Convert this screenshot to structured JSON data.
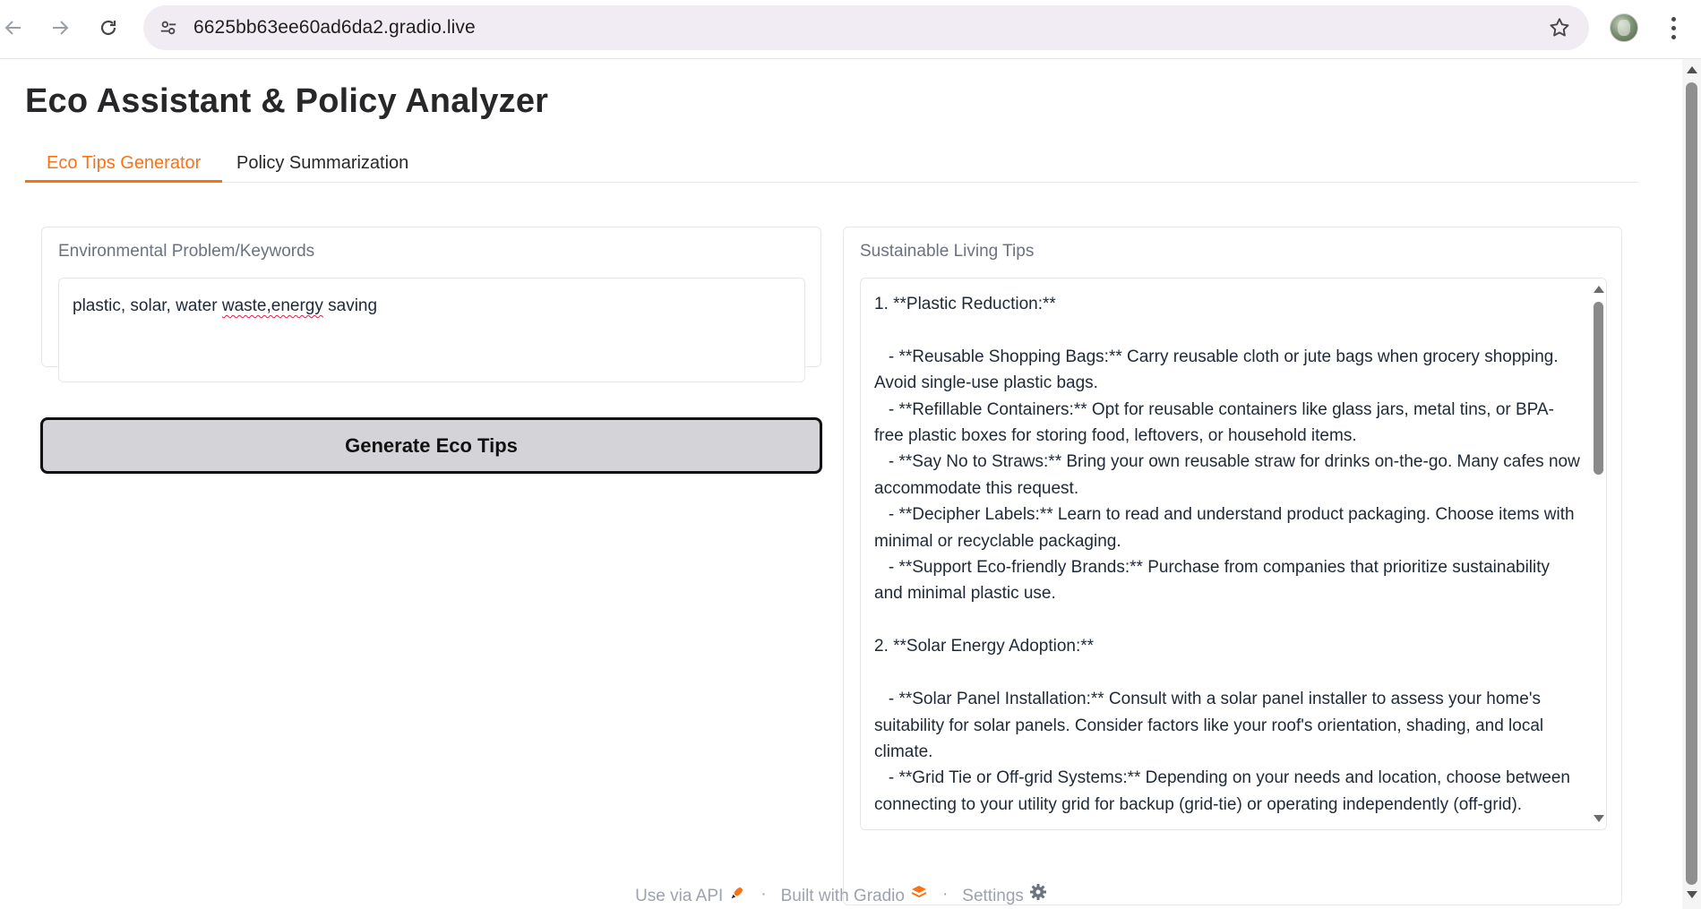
{
  "browser": {
    "url": "6625bb63ee60ad6da2.gradio.live",
    "icons": {
      "back": "arrow-left-icon",
      "forward": "arrow-right-icon",
      "reload": "reload-icon",
      "site_info": "tune-icon",
      "bookmark": "star-icon",
      "menu": "kebab-icon"
    }
  },
  "app": {
    "title": "Eco Assistant & Policy Analyzer",
    "accent_color": "#f97316",
    "tabs": [
      {
        "label": "Eco Tips Generator",
        "active": true
      },
      {
        "label": "Policy Summarization",
        "active": false
      }
    ],
    "input": {
      "label": "Environmental Problem/Keywords",
      "value_prefix": "plastic, solar, water ",
      "value_misspelled": "waste,energy",
      "value_suffix": " saving"
    },
    "generate_button": "Generate Eco Tips",
    "output": {
      "label": "Sustainable Living Tips",
      "text": "1. **Plastic Reduction:**\n\n   - **Reusable Shopping Bags:** Carry reusable cloth or jute bags when grocery shopping. Avoid single-use plastic bags.\n   - **Refillable Containers:** Opt for reusable containers like glass jars, metal tins, or BPA-free plastic boxes for storing food, leftovers, or household items.\n   - **Say No to Straws:** Bring your own reusable straw for drinks on-the-go. Many cafes now accommodate this request.\n   - **Decipher Labels:** Learn to read and understand product packaging. Choose items with minimal or recyclable packaging.\n   - **Support Eco-friendly Brands:** Purchase from companies that prioritize sustainability and minimal plastic use.\n\n2. **Solar Energy Adoption:**\n\n   - **Solar Panel Installation:** Consult with a solar panel installer to assess your home's suitability for solar panels. Consider factors like your roof's orientation, shading, and local climate.\n   - **Grid Tie or Off-grid Systems:** Depending on your needs and location, choose between connecting to your utility grid for backup (grid-tie) or operating independently (off-grid)."
    },
    "footer": {
      "api": "Use via API",
      "separator": "·",
      "built": "Built with Gradio",
      "settings": "Settings"
    }
  }
}
